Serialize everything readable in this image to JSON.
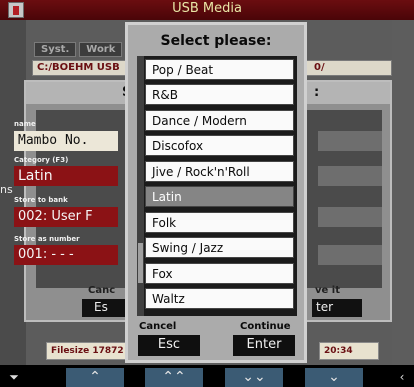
{
  "header": {
    "title": "USB Media"
  },
  "background": {
    "tabs": [
      "Syst.",
      "Work"
    ],
    "path": "C:/BOEHM USB",
    "path_right": "0/",
    "side_label": "ns",
    "filesize": "Filesize 17872",
    "time": "20:34"
  },
  "save_dialog": {
    "title_left": "S",
    "title_right": ":",
    "name_label": "name",
    "name_value": "Mambo No.",
    "category_label": "Category (F3)",
    "category_value": "Latin",
    "bank_label": "Store to bank",
    "bank_value": "002: User F",
    "number_label": "Store as number",
    "number_value": "001: - - -",
    "cancel_label": "Canc",
    "cancel_key": "Es",
    "save_label": "ve it",
    "save_key": "ter"
  },
  "select_dialog": {
    "title": "Select please:",
    "items": [
      "Pop / Beat",
      "R&B",
      "Dance / Modern",
      "Discofox",
      "Jive / Rock'n'Roll",
      "Latin",
      "Folk",
      "Swing / Jazz",
      "Fox",
      "Waltz"
    ],
    "selected": "Latin",
    "cancel_label": "Cancel",
    "cancel_key": "Esc",
    "continue_label": "Continue",
    "continue_key": "Enter"
  },
  "nav": {
    "left_edge": "⏷",
    "buttons": [
      "⌃",
      "⌃⌃",
      "⌄⌄",
      "⌄"
    ],
    "right_edge": "‹"
  },
  "colors": {
    "header_bg": "#5b080b",
    "accent_red": "#8b1215",
    "nav_blue": "#3b5b74",
    "selected_item": "#858585"
  }
}
